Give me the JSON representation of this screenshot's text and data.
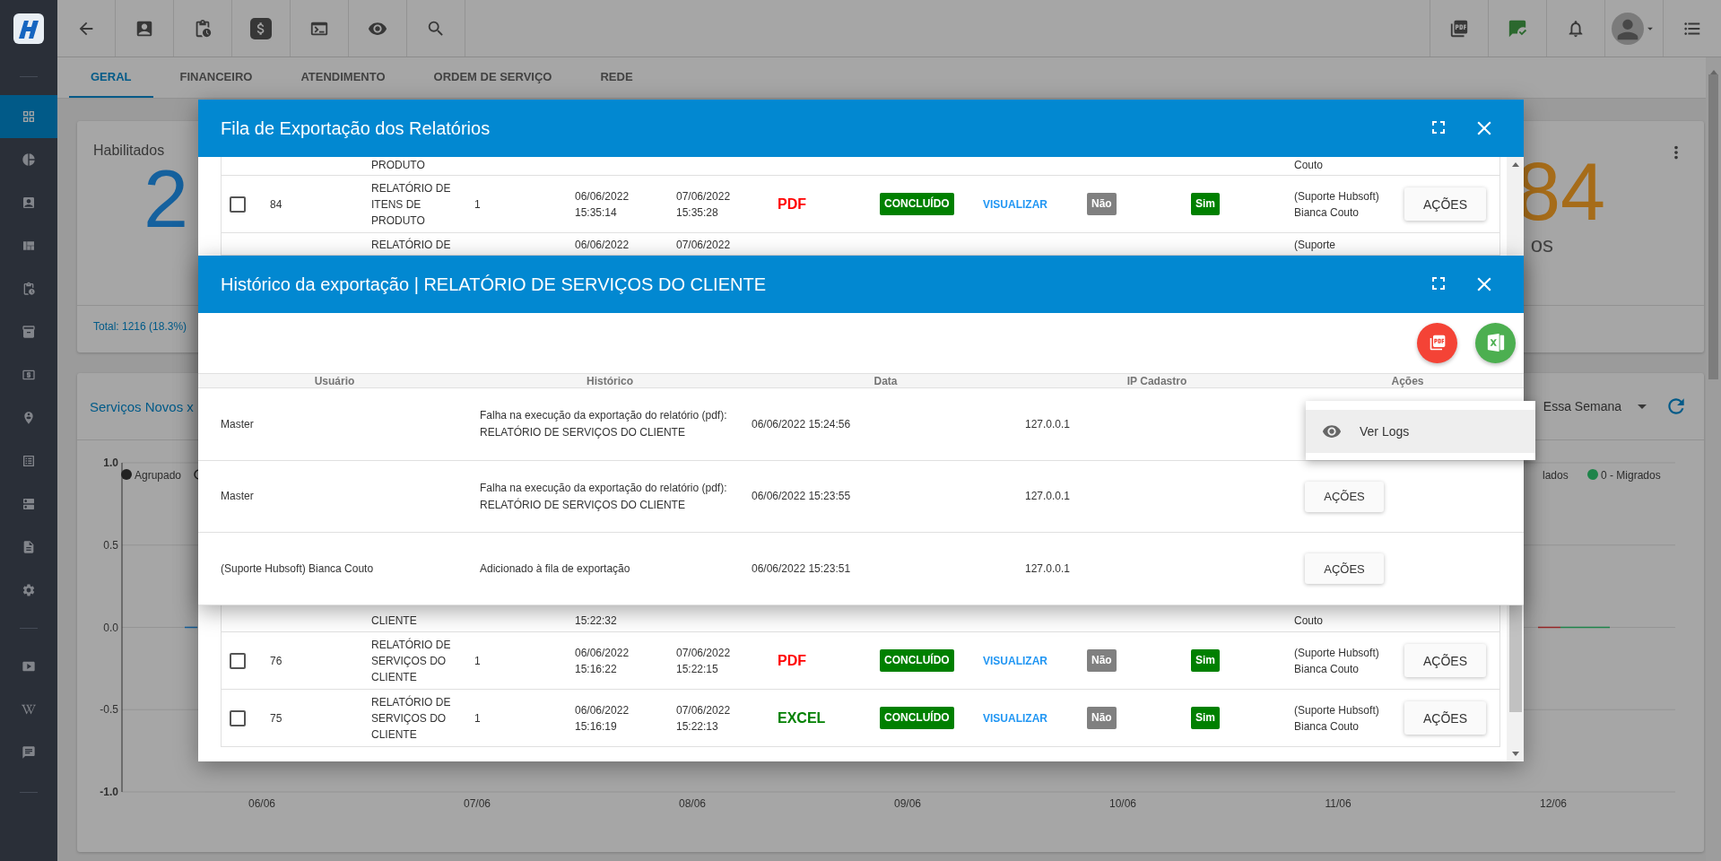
{
  "sidebar": {
    "groups": [
      [
        {
          "selected": true
        },
        {
          "selected": false
        },
        {
          "selected": false
        },
        {
          "selected": false
        },
        {
          "selected": false
        },
        {
          "selected": false
        },
        {
          "selected": false
        },
        {
          "selected": false
        },
        {
          "selected": false
        },
        {
          "selected": false
        },
        {
          "selected": false
        },
        {
          "selected": false
        }
      ],
      [
        {
          "selected": false
        },
        {
          "selected": false
        },
        {
          "selected": false
        }
      ]
    ]
  },
  "tabs": [
    {
      "label": "GERAL",
      "selected": true
    },
    {
      "label": "FINANCEIRO",
      "selected": false
    },
    {
      "label": "ATENDIMENTO",
      "selected": false
    },
    {
      "label": "ORDEM DE SERVIÇO",
      "selected": false
    },
    {
      "label": "REDE",
      "selected": false
    }
  ],
  "cards": [
    {
      "title": "Habilitados",
      "value": "2",
      "color": "#15619e",
      "footer": "Total: 1216 (18.3%)"
    },
    {
      "value": "84",
      "color": "#a66c19",
      "caption": "os"
    }
  ],
  "chart_card": {
    "title": "Serviços Novos x",
    "period": "Essa Semana",
    "legend": [
      {
        "label": "Agrupado",
        "color": "#222222"
      },
      {
        "label": "lados"
      },
      {
        "label": "0 - Migrados",
        "color": "#1e844a"
      }
    ],
    "y_ticks": [
      "1.0",
      "0.5",
      "0.0",
      "-0.5",
      "-1.0"
    ],
    "x_labels": [
      "06/06",
      "07/06",
      "08/06",
      "09/06",
      "10/06",
      "11/06",
      "12/06"
    ]
  },
  "export_queue": {
    "title": "Fila de Exportação dos Relatórios",
    "rows_above": [
      {
        "kind": "cut_top",
        "column_3": "PRODUTO",
        "column_12": "Couto"
      },
      {
        "kind": "full",
        "checked": false,
        "column_2": "84",
        "column_3": "RELATÓRIO DE ITENS DE PRODUTO",
        "column_4": "1",
        "column_5": "06/06/2022 15:35:14",
        "column_6": "07/06/2022 15:35:28",
        "column_7": {
          "text": "PDF",
          "kind": "pdf"
        },
        "column_8": {
          "text": "CONCLUÍDO",
          "kind": "done"
        },
        "column_9": "VISUALIZAR",
        "column_10": {
          "text": "Não",
          "kind": "no"
        },
        "column_11": {
          "text": "Sim",
          "kind": "yes"
        },
        "column_12": "(Suporte Hubsoft) Bianca Couto",
        "actions": "AÇÕES"
      },
      {
        "kind": "cut_bottom",
        "column_3": "RELATÓRIO DE",
        "column_5": "06/06/2022",
        "column_6": "07/06/2022",
        "column_12": "(Suporte"
      }
    ],
    "rows_below": [
      {
        "kind": "cut_top",
        "column_3": "CLIENTE",
        "column_5": "15:22:32",
        "column_12": "Couto"
      },
      {
        "kind": "full",
        "checked": false,
        "column_2": "76",
        "column_3": "RELATÓRIO DE SERVIÇOS DO CLIENTE",
        "column_4": "1",
        "column_5": "06/06/2022 15:16:22",
        "column_6": "07/06/2022 15:22:15",
        "column_7": {
          "text": "PDF",
          "kind": "pdf"
        },
        "column_8": {
          "text": "CONCLUÍDO",
          "kind": "done"
        },
        "column_9": "VISUALIZAR",
        "column_10": {
          "text": "Não",
          "kind": "no"
        },
        "column_11": {
          "text": "Sim",
          "kind": "yes"
        },
        "column_12": "(Suporte Hubsoft) Bianca Couto",
        "actions": "AÇÕES"
      },
      {
        "kind": "full",
        "checked": false,
        "column_2": "75",
        "column_3": "RELATÓRIO DE SERVIÇOS DO CLIENTE",
        "column_4": "1",
        "column_5": "06/06/2022 15:16:19",
        "column_6": "07/06/2022 15:22:13",
        "column_7": {
          "text": "EXCEL",
          "kind": "excel"
        },
        "column_8": {
          "text": "CONCLUÍDO",
          "kind": "done"
        },
        "column_9": "VISUALIZAR",
        "column_10": {
          "text": "Não",
          "kind": "no"
        },
        "column_11": {
          "text": "Sim",
          "kind": "yes"
        },
        "column_12": "(Suporte Hubsoft) Bianca Couto",
        "actions": "AÇÕES"
      }
    ]
  },
  "export_history": {
    "title": "Histórico da exportação | RELATÓRIO DE SERVIÇOS DO CLIENTE",
    "columns": [
      "Usuário",
      "Histórico",
      "Data",
      "IP Cadastro",
      "Ações"
    ],
    "rows": [
      {
        "user": "Master",
        "history": "Falha na execução da exportação do relatório (pdf): RELATÓRIO DE SERVIÇOS DO CLIENTE",
        "date": "06/06/2022 15:24:56",
        "ip": "127.0.0.1"
      },
      {
        "user": "Master",
        "history": "Falha na execução da exportação do relatório (pdf): RELATÓRIO DE SERVIÇOS DO CLIENTE",
        "date": "06/06/2022 15:23:55",
        "ip": "127.0.0.1",
        "actions": "AÇÕES"
      },
      {
        "user": "(Suporte Hubsoft) Bianca Couto",
        "history": "Adicionado à fila de exportação",
        "date": "06/06/2022 15:23:51",
        "ip": "127.0.0.1",
        "actions": "AÇÕES"
      }
    ],
    "menu": {
      "items": [
        {
          "label": "Ver Logs",
          "selected": true
        }
      ]
    }
  }
}
